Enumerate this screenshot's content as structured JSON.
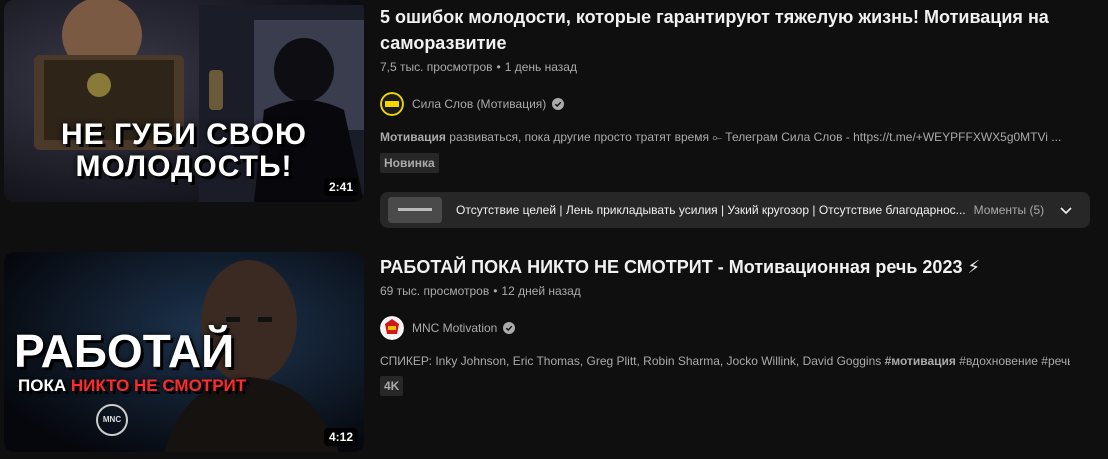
{
  "results": [
    {
      "title": "5 ошибок молодости, которые гарантируют тяжелую жизнь! Мотивация на саморазвитие",
      "views": "7,5 тыс. просмотров",
      "age": "1 день назад",
      "channel": "Сила Слов (Мотивация)",
      "avatar_text": "СИЛА СЛОВ",
      "snippet_bold": "Мотивация",
      "snippet_rest": " развиваться, пока другие просто тратят время ⟜ Телеграм Сила Слов - https://t.me/+WEYPFFXWX5g0MTVi ...",
      "badge": "Новинка",
      "duration": "2:41",
      "thumb_line1": "НЕ ГУБИ СВОЮ",
      "thumb_line2": "МОЛОДОСТЬ!",
      "moments_text": "Отсутствие целей | Лень прикладывать усилия | Узкий кругозор | Отсутствие благодарнос...",
      "moments_count": "Моменты (5)"
    },
    {
      "title": "РАБОТАЙ ПОКА НИКТО НЕ СМОТРИТ - Мотивационная речь 2023 ⚡",
      "views": "69 тыс. просмотров",
      "age": "12 дней назад",
      "channel": "MNC Motivation",
      "avatar_text": "MNC",
      "snippet_pre": "СПИКЕР: Inky Johnson, Eric Thomas, Greg Plitt, Robin Sharma, Jocko Willink, David Goggins ",
      "snippet_bold": "#мотивация",
      "snippet_rest": " #вдохновение #речь ...",
      "badge": "4K",
      "duration": "4:12",
      "thumb_big": "РАБОТАЙ",
      "thumb_small_a": "ПОКА ",
      "thumb_small_b": "НИКТО НЕ СМОТРИТ",
      "thumb_logo": "MNC"
    }
  ],
  "colors": {
    "bg": "#0f0f0f",
    "text": "#f1f1f1",
    "meta": "#aaaaaa",
    "chip": "#272727",
    "accent_red": "#e81f1f"
  },
  "icons": [
    "verified-badge-icon",
    "chevron-down-icon"
  ]
}
